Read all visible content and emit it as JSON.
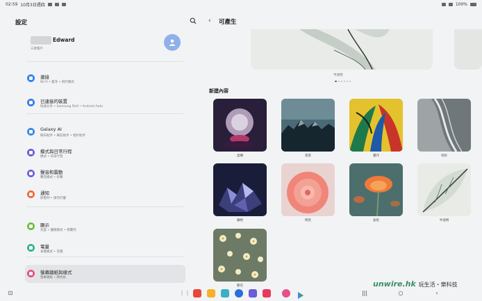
{
  "status_bar": {
    "time": "02:59",
    "date": "10月3日週四",
    "battery": "100%"
  },
  "settings": {
    "title": "設定",
    "profile": {
      "name": "Edward",
      "account_label": "三星帳戶"
    },
    "items": [
      {
        "title": "連接",
        "subtitle": "Wi-Fi • 藍牙 • 飛行模式",
        "icon": "wifi-icon",
        "color": "#2f7ff5"
      },
      {
        "title": "已連接的裝置",
        "subtitle": "快速分享 • Samsung DeX • Android Auto",
        "icon": "devices-icon",
        "color": "#3b7ae8"
      },
      {
        "title": "Galaxy AI",
        "subtitle": "聊天助手 • 筆記助手 • 相片助手",
        "icon": "galaxy-ai-icon",
        "color": "#3a87e8"
      },
      {
        "title": "模式與日常行程",
        "subtitle": "模式 • 日常行程",
        "icon": "modes-icon",
        "color": "#6b5fd6"
      },
      {
        "title": "聲音和震動",
        "subtitle": "聲音模式 • 鈴聲",
        "icon": "sound-icon",
        "color": "#6d63d8"
      },
      {
        "title": "通知",
        "subtitle": "狀態列 • 請勿打擾",
        "icon": "notification-icon",
        "color": "#ee6a3a"
      },
      {
        "title": "顯示",
        "subtitle": "亮度 • 護眼模式 • 導覽列",
        "icon": "display-icon",
        "color": "#6cbf3a"
      },
      {
        "title": "電量",
        "subtitle": "省電模式 • 充電",
        "icon": "battery-icon",
        "color": "#2fb58a"
      },
      {
        "title": "螢幕牆紙與樣式",
        "subtitle": "螢幕牆紙 • 顏色板",
        "icon": "wallpaper-icon",
        "color": "#e8507a"
      }
    ]
  },
  "generative": {
    "title": "可產生",
    "hero_caption": "半透明",
    "section_label": "新建內容",
    "tiles": [
      {
        "caption": "虛構",
        "style": "crystal"
      },
      {
        "caption": "夜景",
        "style": "mountain"
      },
      {
        "caption": "畫作",
        "style": "painting"
      },
      {
        "caption": "地形",
        "style": "terrain"
      },
      {
        "caption": "礦物",
        "style": "mineral"
      },
      {
        "caption": "明亮",
        "style": "dahlia"
      },
      {
        "caption": "柔焦",
        "style": "poppy"
      },
      {
        "caption": "半透明",
        "style": "leaf"
      },
      {
        "caption": "繁花",
        "style": "blossom"
      }
    ]
  },
  "watermark": {
    "brand": "unwire.hk",
    "tagline": "玩生活・樂科技"
  }
}
